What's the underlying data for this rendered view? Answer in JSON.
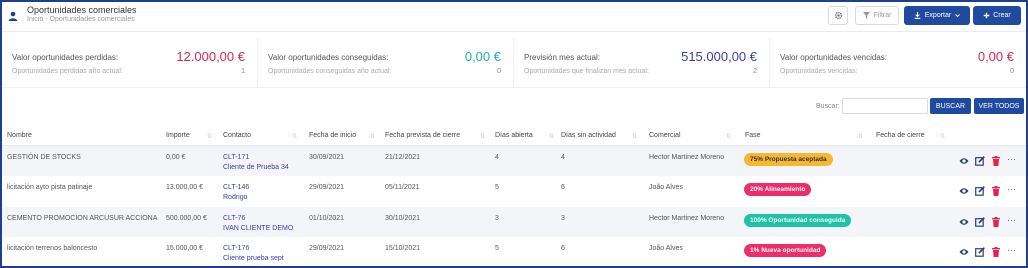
{
  "header": {
    "title": "Oportunidades comerciales",
    "breadcrumb": "Inicio - Oportunidades comerciales",
    "filter_label": "Filtrar",
    "export_label": "Exportar",
    "create_label": "Crear"
  },
  "cards": [
    {
      "label": "Valor oportunidades perdidas:",
      "value": "12.000,00 €",
      "sublabel": "Oportunidades perdidas año actual:",
      "count": "1",
      "color": "#e0264f"
    },
    {
      "label": "Valor oportunidades conseguidas:",
      "value": "0,00 €",
      "sublabel": "Oportunidades conseguidas año actual:",
      "count": "0",
      "color": "#1bb5a3"
    },
    {
      "label": "Previsión mes actual:",
      "value": "515.000,00 €",
      "sublabel": "Oportunidades que finalizan mes actual:",
      "count": "2",
      "color": "#3a3fa6"
    },
    {
      "label": "Valor oportunidades vencidas:",
      "value": "0,00 €",
      "sublabel": "Oportunidades vencidas:",
      "count": "0",
      "color": "#e0264f"
    }
  ],
  "search": {
    "label": "Buscar:",
    "value": "",
    "search_button": "BUSCAR",
    "view_all_button": "VER TODOS"
  },
  "table": {
    "columns": [
      "Nombre",
      "Importe",
      "Contacto",
      "Fecha de inicio",
      "Fecha prevista de cierre",
      "Días abierta",
      "Días sin actividad",
      "Comercial",
      "Fase",
      "Fecha de cierre"
    ],
    "rows": [
      {
        "nombre": "GESTIÓN DE STOCKS",
        "importe": "0,00 €",
        "contacto_id": "CLT-171",
        "contacto_name": "Cliente de Prueba 34",
        "inicio": "30/09/2021",
        "cierre_prevista": "21/12/2021",
        "dias_abierta": "4",
        "dias_sin_actividad": "4",
        "comercial": "Hector Martinez Moreno",
        "fase": "75% Propuesta aceptada",
        "fase_bg": "#f7b733",
        "fase_fg": "#333333",
        "fecha_cierre": ""
      },
      {
        "nombre": "licitación ayto pista patinaje",
        "importe": "13.000,00 €",
        "contacto_id": "CLT-146",
        "contacto_name": "Rodrigo",
        "inicio": "29/09/2021",
        "cierre_prevista": "05/11/2021",
        "dias_abierta": "5",
        "dias_sin_actividad": "6",
        "comercial": "João Alves",
        "fase": "20% Alineamiento",
        "fase_bg": "#ec2f6b",
        "fase_fg": "#ffffff",
        "fecha_cierre": ""
      },
      {
        "nombre": "CEMENTO PROMOCION ARCUSUR ACCIONA",
        "importe": "500.000,00 €",
        "contacto_id": "CLT-76",
        "contacto_name": "IVAN CLIENTE DEMO",
        "inicio": "01/10/2021",
        "cierre_prevista": "30/10/2021",
        "dias_abierta": "3",
        "dias_sin_actividad": "3",
        "comercial": "Hector Martinez Moreno",
        "fase": "100% Oportunidad conseguida",
        "fase_bg": "#1cc3a7",
        "fase_fg": "#ffffff",
        "fecha_cierre": ""
      },
      {
        "nombre": "licitación terrenos baloncesto",
        "importe": "15.000,00 €",
        "contacto_id": "CLT-176",
        "contacto_name": "Cliente prueba sept",
        "inicio": "29/09/2021",
        "cierre_prevista": "15/10/2021",
        "dias_abierta": "5",
        "dias_sin_actividad": "6",
        "comercial": "João Alves",
        "fase": "1% Nueva oportunidad",
        "fase_bg": "#ec2f6b",
        "fase_fg": "#ffffff",
        "fecha_cierre": ""
      }
    ]
  },
  "colors": {
    "primary": "#1f4aa0",
    "frame": "#1f3f8a"
  }
}
